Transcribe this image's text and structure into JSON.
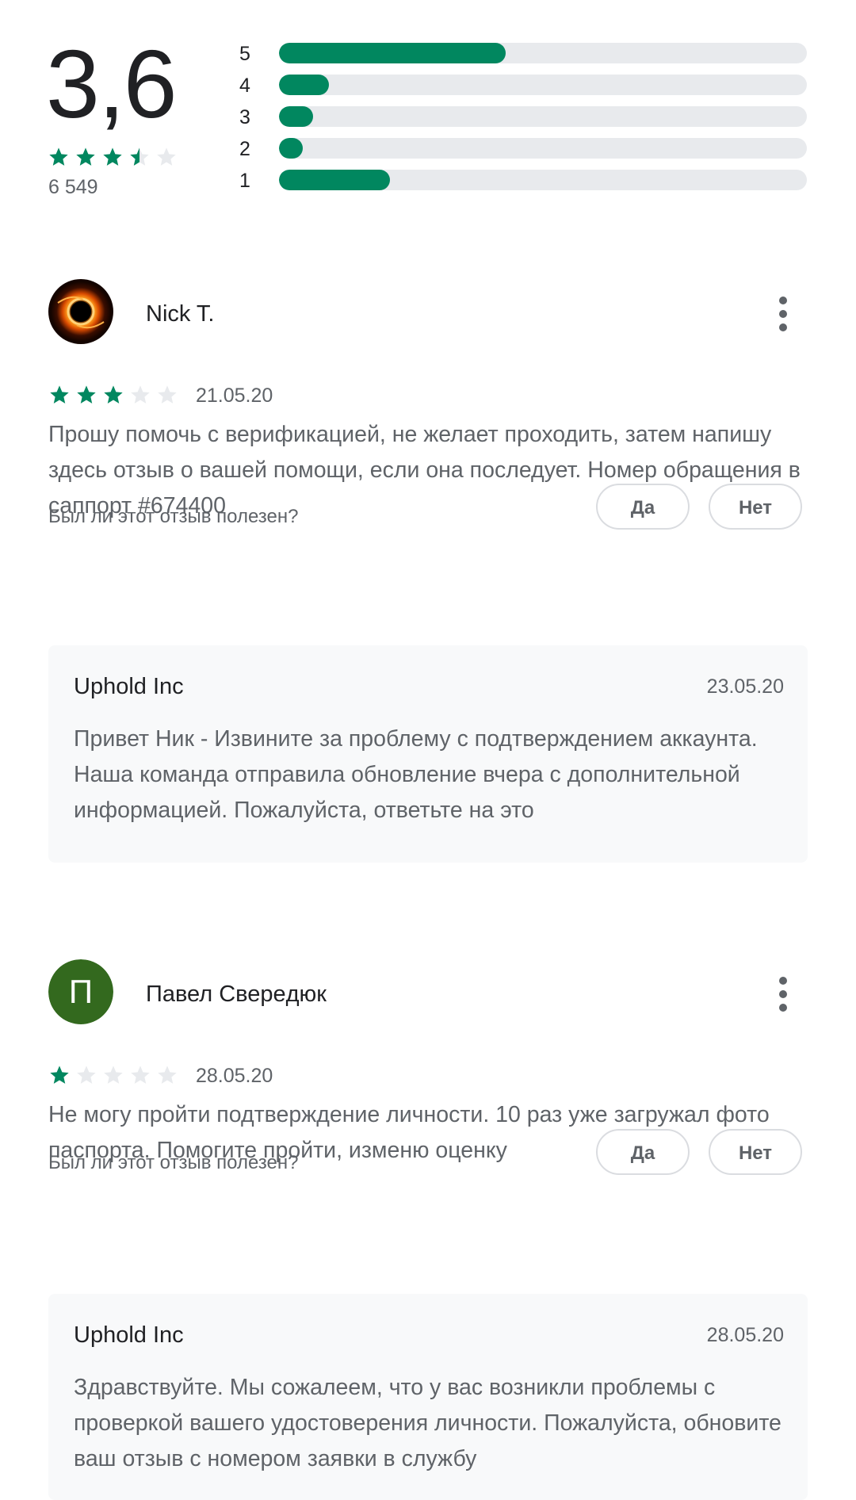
{
  "summary": {
    "score": "3,6",
    "total_count": "6 549",
    "stars": 3.5,
    "distribution": [
      {
        "label": "5",
        "fraction": 0.43
      },
      {
        "label": "4",
        "fraction": 0.095
      },
      {
        "label": "3",
        "fraction": 0.065
      },
      {
        "label": "2",
        "fraction": 0.045
      },
      {
        "label": "1",
        "fraction": 0.21
      }
    ]
  },
  "colors": {
    "accent": "#01875f",
    "star_empty": "#e8eaed",
    "track": "#e8eaed",
    "avatar_green": "#33691e"
  },
  "reviews": [
    {
      "author": "Nick T.",
      "avatar": "fire-ring-avatar",
      "stars": 3,
      "date": "21.05.20",
      "text": "Прошу помочь с верификацией, не желает проходить, затем напишу здесь отзыв о вашей помощи, если она последует. Номер обращения в саппорт #674400",
      "helpful_question": "Был ли этот отзыв полезен?",
      "yes_label": "Да",
      "no_label": "Нет",
      "reply": {
        "author": "Uphold Inc",
        "date": "23.05.20",
        "text": "Привет Ник - Извините за проблему с подтверждением аккаунта. Наша команда отправила обновление вчера с дополнительной информацией. Пожалуйста, ответьте на это"
      }
    },
    {
      "author": "Павел Сверeдюк",
      "avatar_letter": "П",
      "stars": 1,
      "date": "28.05.20",
      "text": "Не могу пройти подтверждение личности. 10 раз уже загружал фото паспорта. Помогите пройти, изменю оценку",
      "helpful_question": "Был ли этот отзыв полезен?",
      "yes_label": "Да",
      "no_label": "Нет",
      "reply": {
        "author": "Uphold Inc",
        "date": "28.05.20",
        "text": "Здравствуйте. Мы сожалеем, что у вас возникли проблемы с проверкой вашего удостоверения личности. Пожалуйста, обновите ваш отзыв с номером заявки в службу"
      }
    }
  ]
}
